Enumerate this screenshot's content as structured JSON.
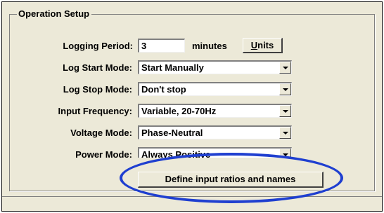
{
  "group": {
    "title": "Operation Setup"
  },
  "rows": {
    "logging_period": {
      "label": "Logging Period:",
      "value": "3",
      "unit": "minutes",
      "button_label": "Units",
      "button_accesskey": "U",
      "button_rest": "nits"
    },
    "log_start_mode": {
      "label": "Log Start Mode:",
      "value": "Start Manually"
    },
    "log_stop_mode": {
      "label": "Log Stop Mode:",
      "value": "Don't stop"
    },
    "input_frequency": {
      "label": "Input Frequency:",
      "value": "Variable, 20-70Hz"
    },
    "voltage_mode": {
      "label": "Voltage Mode:",
      "value": "Phase-Neutral"
    },
    "power_mode": {
      "label": "Power Mode:",
      "value": "Always Positive"
    }
  },
  "define_button": {
    "label": "Define input ratios and names"
  },
  "highlight": {
    "color": "#1f3fd0"
  }
}
